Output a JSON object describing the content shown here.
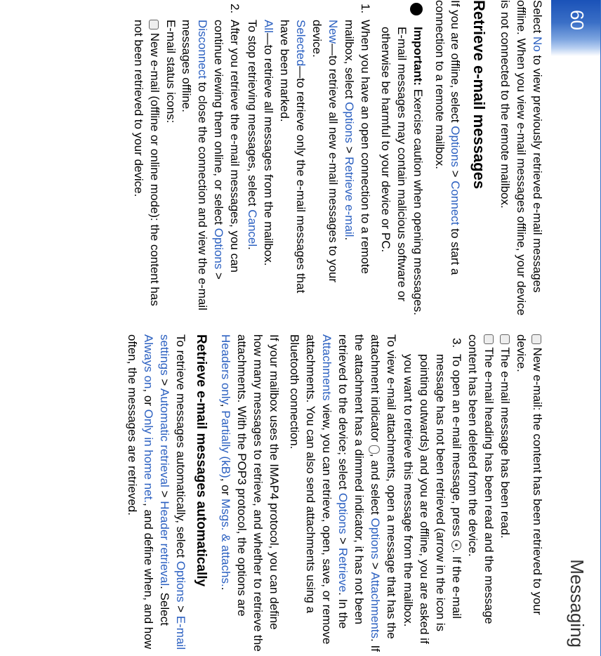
{
  "page": {
    "number": "60",
    "section": "Messaging"
  },
  "colA": {
    "p1a": "Select ",
    "p1_no": "No",
    "p1b": " to view previously retrieved e-mail messages offline. When you view e-mail messages offline, your device is not connected to the remote mailbox.",
    "h3": "Retrieve e-mail messages",
    "p2a": "If you are offline, select ",
    "p2_opt": "Options",
    "p2b": " > ",
    "p2_conn": "Connect",
    "p2c": " to start a connection to a remote mailbox.",
    "note_label": "Important:",
    "note_body": " Exercise caution when opening messages. E-mail messages may contain malicious software or otherwise be harmful to your device or PC.",
    "s1a": "When you have an open connection to a remote mailbox, select ",
    "s1_opt": "Options",
    "s1b": " > ",
    "s1_ret": "Retrieve e-mail",
    "s1c": ".",
    "s1_newL": "New",
    "s1_new": "—to retrieve all new e-mail messages to your device.",
    "s1_selL": "Selected",
    "s1_sel": "—to retrieve only the e-mail messages that have been marked.",
    "s1_allL": "All",
    "s1_all": "—to retrieve all messages from the mailbox.",
    "s1_stopa": "To stop retrieving messages, select ",
    "s1_cancel": "Cancel",
    "s1_stopb": ".",
    "s2a": "After you retrieve the e-mail messages, you can continue viewing them online, or select ",
    "s2_opt": "Options",
    "s2b": " > ",
    "s2_disc": "Disconnect",
    "s2c": " to close the connection and view the e-mail messages offline.",
    "s2_hdr": "E-mail status icons:",
    "s2_ic1": " New e-mail (offline or online mode): the content has not been retrieved to your device."
  },
  "colB": {
    "ic2": " New e-mail: the content has been retrieved to your device.",
    "ic3": " The e-mail message has been read.",
    "ic4": " The e-mail heading has been read and the message content has been deleted from the device.",
    "s3a": "To open an e-mail message, press ",
    "s3b": ". If the e-mail message has not been retrieved (arrow in the icon is pointing outwards) and you are offline, you are asked if you want to retrieve this message from the mailbox.",
    "p_att_a": "To view e-mail attachments, open a message that has the attachment indicator ",
    "p_att_b": ", and select ",
    "p_att_opt": "Options",
    "p_att_c": " > ",
    "p_att_att": "Attachments",
    "p_att_d": ". If the attachment has a dimmed indicator, it has not been retrieved to the device; select ",
    "p_att_opt2": "Options",
    "p_att_e": " > ",
    "p_att_ret": "Retrieve",
    "p_att_f": ". In the ",
    "p_att_view": "Attachments",
    "p_att_g": " view, you can retrieve, open, save, or remove attachments. You can also send attachments using a Bluetooth connection.",
    "p_imap_a": "If your mailbox uses the IMAP4 protocol, you can define how many messages to retrieve, and whether to retrieve the attachments. With the POP3 protocol, the options are ",
    "p_imap_ho": "Headers only",
    "p_imap_c1": ", ",
    "p_imap_pk": "Partially (kB)",
    "p_imap_c2": ", or ",
    "p_imap_ma": "Msgs. & attachs.",
    "p_imap_end": ".",
    "h4": "Retrieve e-mail messages automatically",
    "p_auto_a": "To retrieve messages automatically, select ",
    "p_auto_opt": "Options",
    "p_auto_b": " > ",
    "p_auto_es": "E-mail settings",
    "p_auto_c": " > ",
    "p_auto_ar": "Automatic retrieval",
    "p_auto_d": " > ",
    "p_auto_hr": "Header retrieval",
    "p_auto_e": ". Select ",
    "p_auto_ao": "Always on",
    "p_auto_f": ", or ",
    "p_auto_oh": "Only in home net.",
    "p_auto_g": ", and define when, and how often, the messages are retrieved."
  }
}
